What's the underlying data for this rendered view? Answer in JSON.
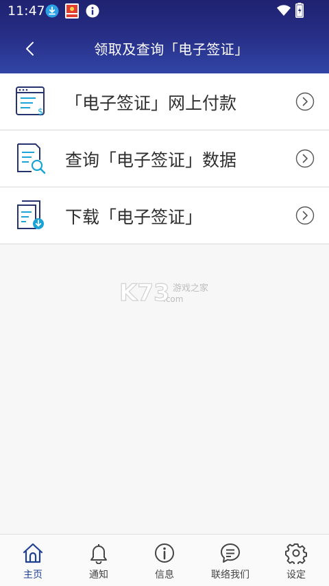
{
  "status_bar": {
    "time": "11:47"
  },
  "header": {
    "title": "领取及查询「电子签证」",
    "back_icon": "chevron-left-icon"
  },
  "menu": {
    "items": [
      {
        "label": "「电子签证」网上付款",
        "icon": "payment-document-icon"
      },
      {
        "label": "查询「电子签证」数据",
        "icon": "search-document-icon"
      },
      {
        "label": "下载「电子签证」",
        "icon": "download-document-icon"
      }
    ]
  },
  "watermark": {
    "text": "游戏之家",
    "domain": ".com"
  },
  "tabbar": {
    "items": [
      {
        "label": "主页",
        "icon": "home-icon",
        "active": true
      },
      {
        "label": "通知",
        "icon": "bell-icon",
        "active": false
      },
      {
        "label": "信息",
        "icon": "info-icon",
        "active": false
      },
      {
        "label": "联络我们",
        "icon": "chat-icon",
        "active": false
      },
      {
        "label": "设定",
        "icon": "gear-icon",
        "active": false
      }
    ]
  },
  "colors": {
    "header": "#262d84",
    "accent": "#1d3f92",
    "icon_teal": "#1aa3d6",
    "icon_navy": "#24336e"
  }
}
